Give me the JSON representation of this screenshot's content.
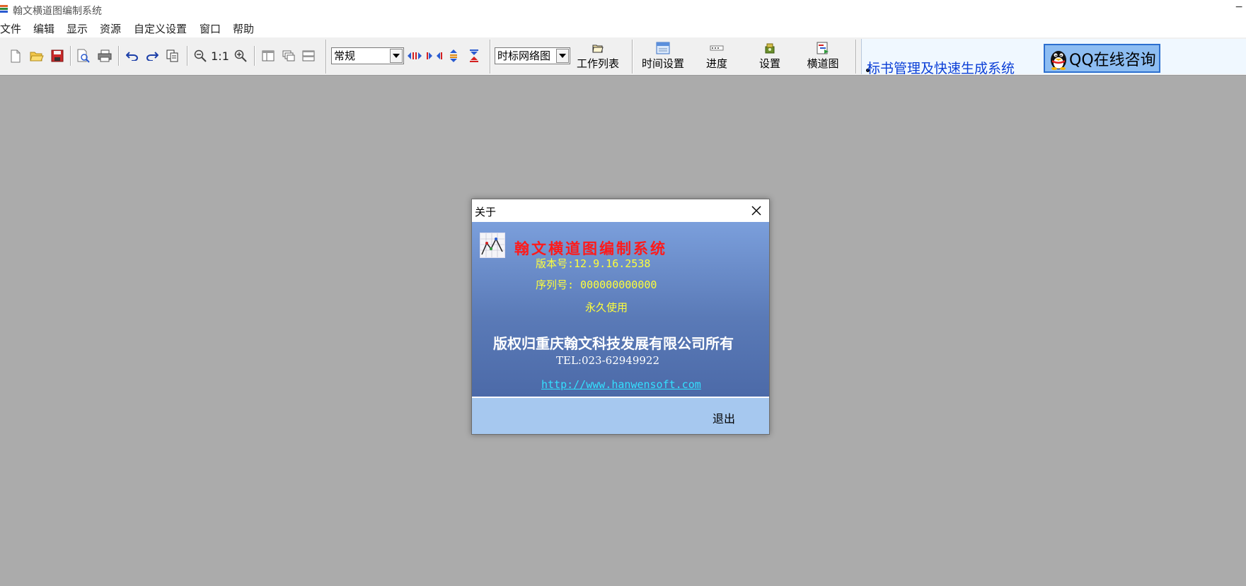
{
  "window": {
    "title": "翰文横道图编制系统",
    "minimize_glyph": "−"
  },
  "menu": [
    "文件",
    "编辑",
    "显示",
    "资源",
    "自定义设置",
    "窗口",
    "帮助"
  ],
  "toolbar": {
    "zoom_reset_label": "1:1",
    "style_combo_value": "常规",
    "view_combo_value": "时标网络图",
    "work_list_label": "工作列表",
    "time_settings_label": "时间设置",
    "progress_label": "进度",
    "settings_label": "设置",
    "gantt_label": "横道图"
  },
  "promo": {
    "link_text": "标书管理及快速生成系统",
    "qq_label": "QQ在线咨询"
  },
  "about_dialog": {
    "title": "关于",
    "product_name": "翰文横道图编制系统",
    "version": "版本号:12.9.16.2538",
    "serial": "序列号: 000000000000",
    "license": "永久使用",
    "copyright": "版权归重庆翰文科技发展有限公司所有",
    "tel": "TEL:023-62949922",
    "url": "http://www.hanwensoft.com",
    "exit_label": "退出"
  },
  "colors": {
    "workspace": "#ababab",
    "dialog_gradient_top": "#7b9fdc",
    "dialog_gradient_bottom": "#4c6aa8",
    "dialog_footer": "#a6c8ef",
    "product_name": "#ff1a1a",
    "info_text": "#ffff3a",
    "link": "#33e0ff",
    "promo_link": "#0b3fd6"
  }
}
